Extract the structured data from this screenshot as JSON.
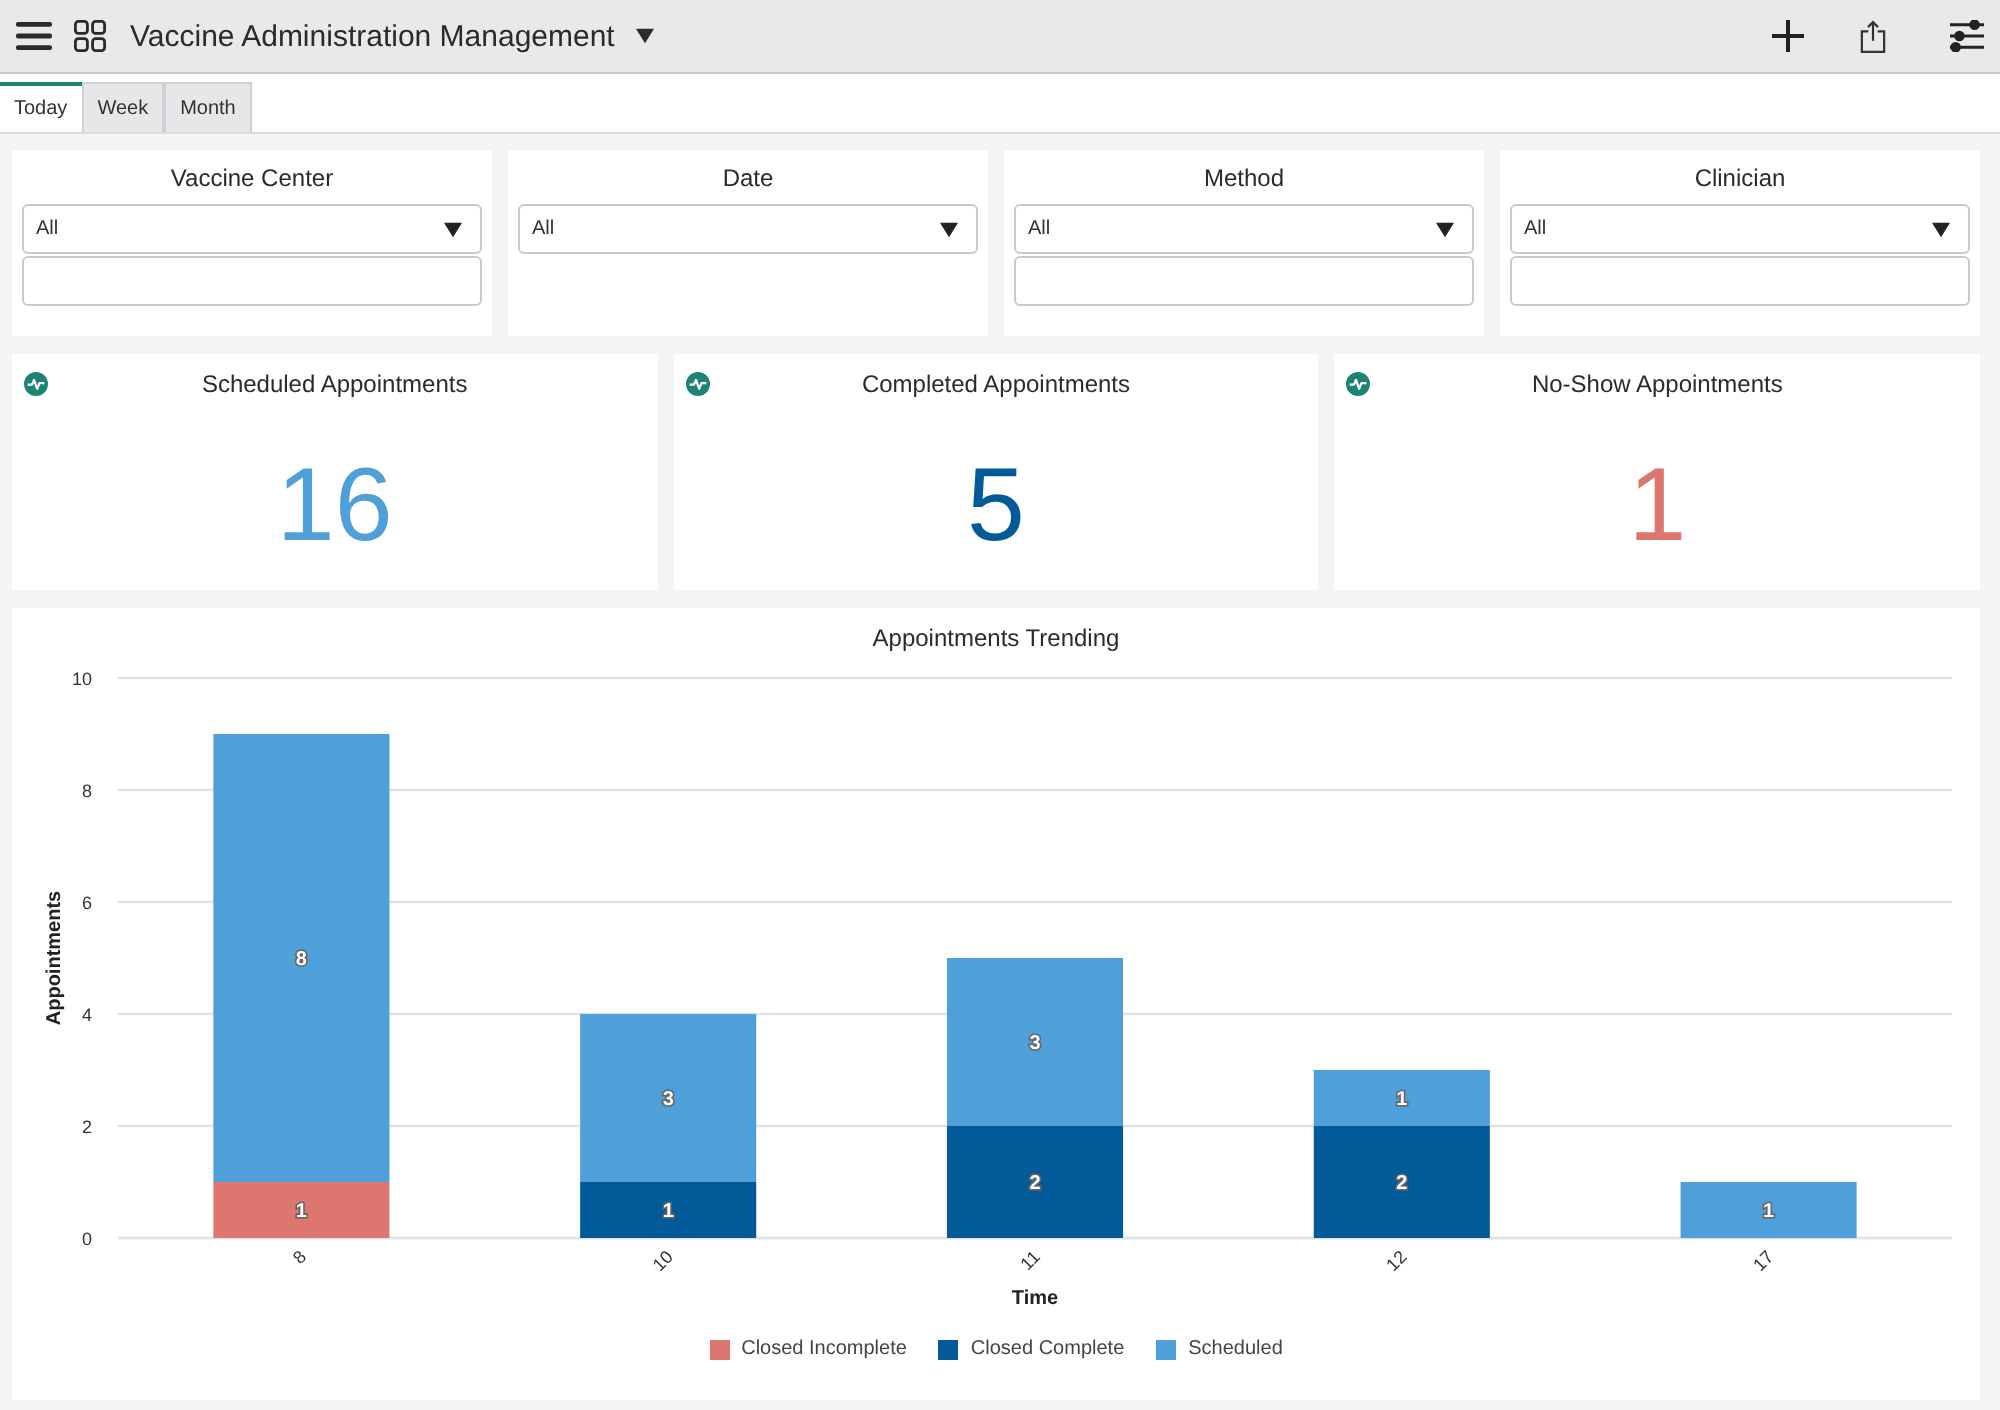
{
  "header": {
    "title": "Vaccine Administration Management"
  },
  "tabs": [
    {
      "label": "Today",
      "selected": true
    },
    {
      "label": "Week",
      "selected": false
    },
    {
      "label": "Month",
      "selected": false
    }
  ],
  "filters": [
    {
      "kind": "combo",
      "label": "Vaccine Center",
      "value": "All"
    },
    {
      "kind": "select",
      "label": "Date",
      "value": "All"
    },
    {
      "kind": "combo",
      "label": "Method",
      "value": "All"
    },
    {
      "kind": "combo",
      "label": "Clinician",
      "value": "All"
    }
  ],
  "kpis": [
    {
      "title": "Scheduled Appointments",
      "value": "16",
      "color": "#4f9fd8"
    },
    {
      "title": "Completed Appointments",
      "value": "5",
      "color": "#035a98"
    },
    {
      "title": "No-Show Appointments",
      "value": "1",
      "color": "#dd766f"
    }
  ],
  "chart": {
    "chart_data": {
      "type": "bar",
      "title": "Appointments Trending",
      "xlabel": "Time",
      "ylabel": "Appointments",
      "categories": [
        "8",
        "10",
        "11",
        "12",
        "17"
      ],
      "series": [
        {
          "name": "Closed Incomplete",
          "color": "#dd766f",
          "values": [
            1,
            0,
            0,
            0,
            0
          ]
        },
        {
          "name": "Closed Complete",
          "color": "#035a98",
          "values": [
            0,
            1,
            2,
            2,
            0
          ]
        },
        {
          "name": "Scheduled",
          "color": "#4f9fd8",
          "values": [
            8,
            3,
            3,
            1,
            1
          ]
        }
      ],
      "ylim": [
        0,
        10
      ],
      "yticks": [
        0,
        2,
        4,
        6,
        8,
        10
      ],
      "stacked": true,
      "grid": true,
      "value_labels": [
        [
          "1",
          null,
          null,
          null,
          null
        ],
        [
          null,
          "1",
          "2",
          "2",
          null
        ],
        [
          "8",
          "3",
          "3",
          "1",
          "1"
        ]
      ]
    }
  }
}
